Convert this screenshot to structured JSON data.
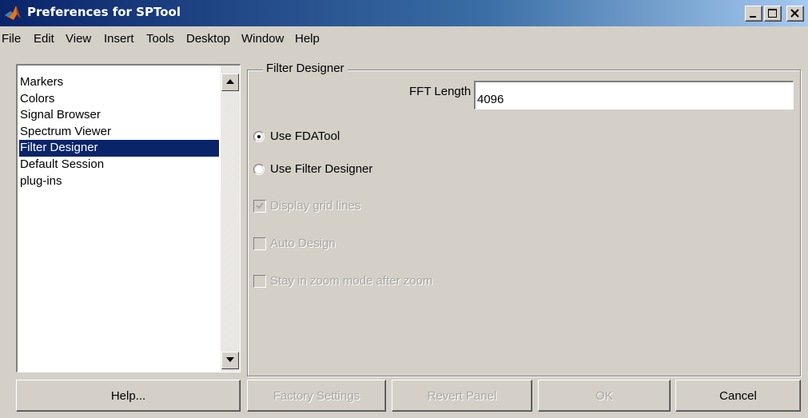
{
  "window": {
    "title": "Preferences for SPTool",
    "app_icon": "matlab-icon",
    "controls": [
      "minimize-icon",
      "maximize-icon",
      "close-icon"
    ]
  },
  "menu": {
    "items": [
      "File",
      "Edit",
      "View",
      "Insert",
      "Tools",
      "Desktop",
      "Window",
      "Help"
    ]
  },
  "sidebar": {
    "items": [
      "Markers",
      "Colors",
      "Signal Browser",
      "Spectrum Viewer",
      "Filter Designer",
      "Default Session",
      "plug-ins"
    ],
    "selected": "Filter Designer"
  },
  "panel": {
    "title": "Filter Designer",
    "fft_label": "FFT Length",
    "fft_value": "4096",
    "radio_fdatool": "Use FDATool",
    "radio_filter_designer": "Use Filter Designer",
    "selected_radio": "Use FDATool",
    "check_grid": "Display grid lines",
    "check_auto": "Auto Design",
    "check_zoom": "Stay in zoom mode after zoom",
    "grid_checked": true,
    "auto_checked": false,
    "zoom_checked": false
  },
  "buttons": {
    "help": "Help...",
    "factory": "Factory Settings",
    "revert": "Revert Panel",
    "ok": "OK",
    "cancel": "Cancel"
  },
  "colors": {
    "face": "#d4d0c8",
    "selection": "#0a246a",
    "title_start": "#0a246a",
    "title_end": "#a6caf0",
    "disabled_text": "#a9a6a0"
  }
}
